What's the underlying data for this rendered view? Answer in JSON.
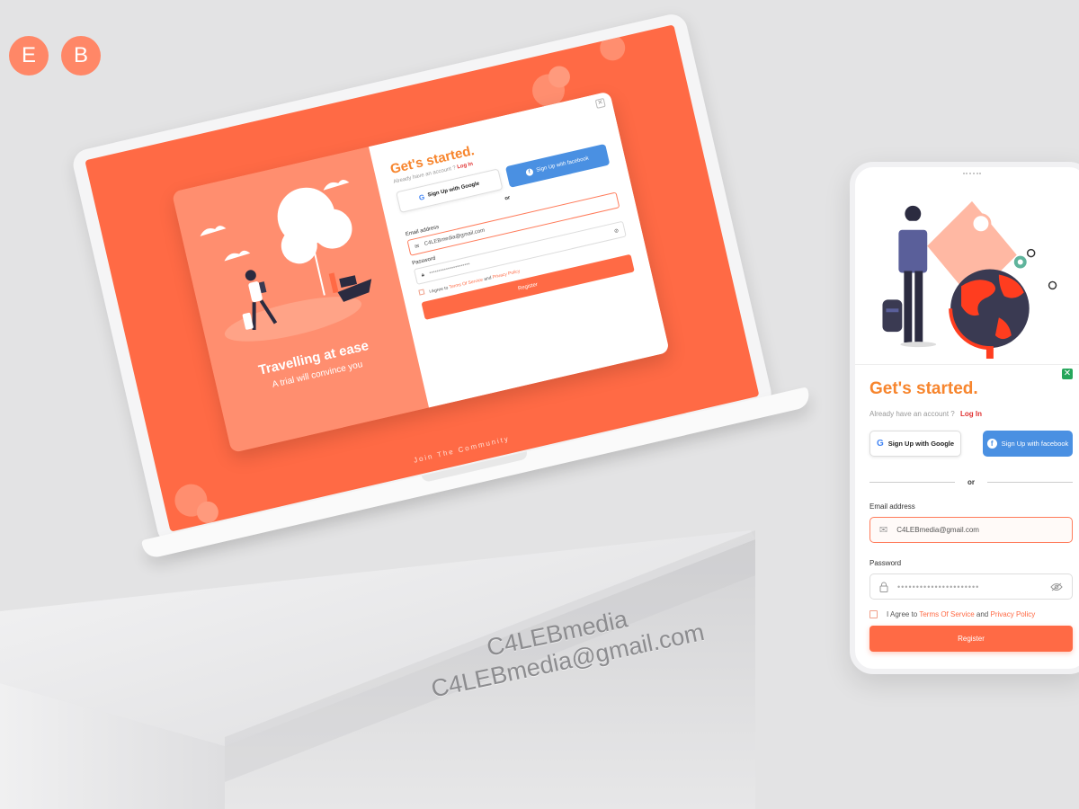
{
  "brand": {
    "logo_letters": [
      "E",
      "B"
    ]
  },
  "watermark": {
    "name": "C4LEBmedia",
    "email": "C4LEBmedia@gmail.com"
  },
  "laptop": {
    "hero_title": "Travelling at ease",
    "hero_subtitle": "A trial will convince you",
    "footer_text": "Join The Community",
    "form": {
      "title": "Get's started.",
      "already_text": "Already have an account ?",
      "login_label": "Log In",
      "google_label": "Sign Up with Google",
      "facebook_label": "Sign Up with facebook",
      "or_label": "or",
      "email_label": "Email address",
      "email_value": "C4LEBmedia@gmail.com",
      "password_label": "Password",
      "password_mask": "••••••••••••••••••••••",
      "agree_prefix": "I Agree to",
      "terms_label": "Terms Of Service",
      "and_label": "and",
      "privacy_label": "Privacy  Policy",
      "register_label": "Register"
    }
  },
  "phone": {
    "title": "Get's started.",
    "already_text": "Already have an account ?",
    "login_label": "Log In",
    "google_label": "Sign Up with Google",
    "facebook_label": "Sign Up with facebook",
    "or_label": "or",
    "email_label": "Email address",
    "email_value": "C4LEBmedia@gmail.com",
    "password_label": "Password",
    "password_mask": "••••••••••••••••••••••",
    "agree_prefix": "I Agree to",
    "terms_label": "Terms Of Service",
    "and_label": "and",
    "privacy_label": "Privacy  Policy",
    "register_label": "Register"
  },
  "colors": {
    "accent": "#ff6a45",
    "title_orange": "#f7852d",
    "facebook_blue": "#4a90e2",
    "login_red": "#e03131",
    "close_green": "#26a65b",
    "background": "#e3e3e4"
  }
}
